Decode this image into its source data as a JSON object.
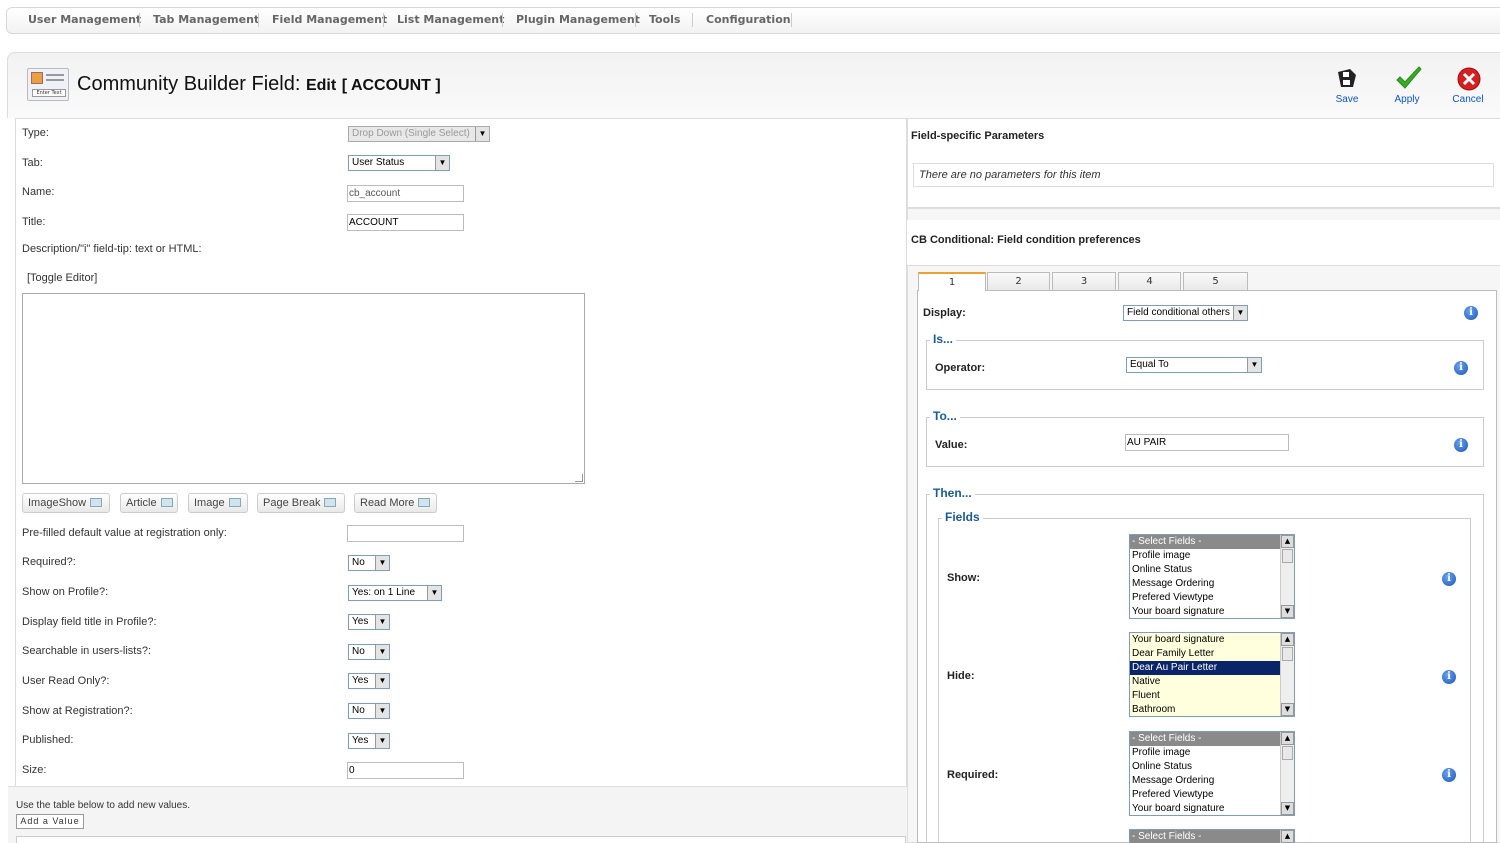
{
  "nav": {
    "items": [
      "User Management",
      "Tab Management",
      "Field Management",
      "List Management",
      "Plugin Management",
      "Tools",
      "Configuration"
    ]
  },
  "header": {
    "title_main": "Community Builder Field:",
    "title_edit": "Edit",
    "title_field": "[ ACCOUNT ]",
    "icon_label": "Enter Text"
  },
  "toolbar": {
    "save": "Save",
    "apply": "Apply",
    "cancel": "Cancel"
  },
  "form": {
    "type_label": "Type:",
    "type_value": "Drop Down (Single Select)",
    "tab_label": "Tab:",
    "tab_value": "User Status",
    "name_label": "Name:",
    "name_value": "cb_account",
    "title_label": "Title:",
    "title_value": "ACCOUNT",
    "desc_label": "Description/\"i\" field-tip: text or HTML:",
    "toggle_editor": "[Toggle Editor]",
    "editor_buttons": [
      "ImageShow",
      "Article",
      "Image",
      "Page Break",
      "Read More"
    ],
    "prefilled_label": "Pre-filled default value at registration only:",
    "prefilled_value": "",
    "required_label": "Required?:",
    "required_value": "No",
    "show_profile_label": "Show on Profile?:",
    "show_profile_value": "Yes: on 1 Line",
    "display_title_label": "Display field title in Profile?:",
    "display_title_value": "Yes",
    "searchable_label": "Searchable in users-lists?:",
    "searchable_value": "No",
    "readonly_label": "User Read Only?:",
    "readonly_value": "Yes",
    "show_reg_label": "Show at Registration?:",
    "show_reg_value": "No",
    "published_label": "Published:",
    "published_value": "Yes",
    "size_label": "Size:",
    "size_value": "0",
    "values_hint": "Use the table below to add new values.",
    "add_value": "Add a Value"
  },
  "right": {
    "params_title": "Field-specific Parameters",
    "params_empty": "There are no parameters for this item",
    "cond_title": "CB Conditional: Field condition preferences",
    "tabs": [
      "1",
      "2",
      "3",
      "4",
      "5"
    ],
    "display_label": "Display:",
    "display_value": "Field conditional others",
    "is_legend": "Is...",
    "operator_label": "Operator:",
    "operator_value": "Equal To",
    "to_legend": "To...",
    "value_label": "Value:",
    "value_value": "AU PAIR",
    "then_legend": "Then...",
    "fields_legend": "Fields",
    "show_label": "Show:",
    "hide_label": "Hide:",
    "required_label": "Required:",
    "show_options": [
      "- Select Fields -",
      "Profile image",
      "Online Status",
      "Message Ordering",
      "Prefered Viewtype",
      "Your board signature"
    ],
    "hide_options": [
      "Your board signature",
      "Dear Family Letter",
      "Dear Au Pair Letter",
      "Native",
      "Fluent",
      "Bathroom"
    ],
    "required_options": [
      "- Select Fields -",
      "Profile image",
      "Online Status",
      "Message Ordering",
      "Prefered Viewtype",
      "Your board signature"
    ],
    "next_options": [
      "- Select Fields -"
    ]
  }
}
